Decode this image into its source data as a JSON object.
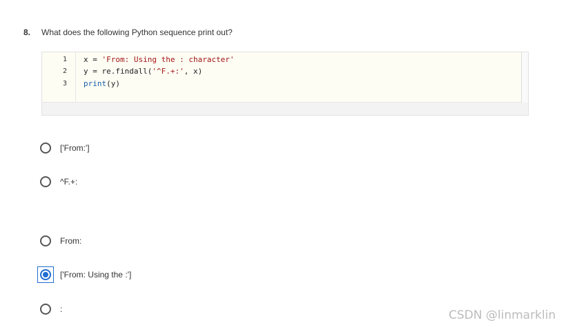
{
  "question": {
    "number": "8.",
    "text": "What does the following Python sequence print out?"
  },
  "code": {
    "line_numbers": [
      "1",
      "2",
      "3"
    ],
    "line1": {
      "prefix": "x = ",
      "string": "'From: Using the : character'"
    },
    "line2": {
      "prefix": "y = re.findall(",
      "string": "'^F.+:'",
      "suffix": ", x)"
    },
    "line3": {
      "keyword": "print",
      "suffix": "(y)"
    }
  },
  "options": [
    {
      "label": "['From:']",
      "selected": false
    },
    {
      "label": "^F.+:",
      "selected": false
    },
    {
      "label": "From:",
      "selected": false
    },
    {
      "label": "['From: Using the :']",
      "selected": true
    },
    {
      "label": ":",
      "selected": false
    }
  ],
  "watermark": "CSDN @linmarklin",
  "colors": {
    "selected_accent": "#1f6dd1",
    "string": "#a31515",
    "keyword": "#1c5fa8"
  }
}
